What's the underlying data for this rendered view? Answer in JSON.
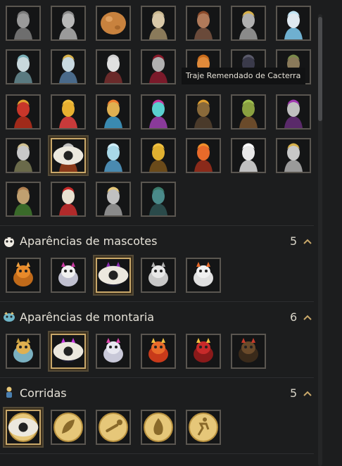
{
  "tooltip": {
    "text": "Traje Remendado de Cacterra"
  },
  "sections": [
    {
      "title": "Aparências de mascotes",
      "count": "5"
    },
    {
      "title": "Aparências de montaria",
      "count": "6"
    },
    {
      "title": "Corridas",
      "count": "5"
    }
  ],
  "colors": {
    "accent_gold": "#c9a86a",
    "slot_border": "#5a5650",
    "background": "#1c1d1e",
    "badge_gold": "#e6c779"
  },
  "icons": {
    "costume": "character-portrait-icon",
    "pet": "pet-icon",
    "mount": "mount-icon",
    "race": "race-emblem-icon",
    "visibility": "eye-icon"
  }
}
